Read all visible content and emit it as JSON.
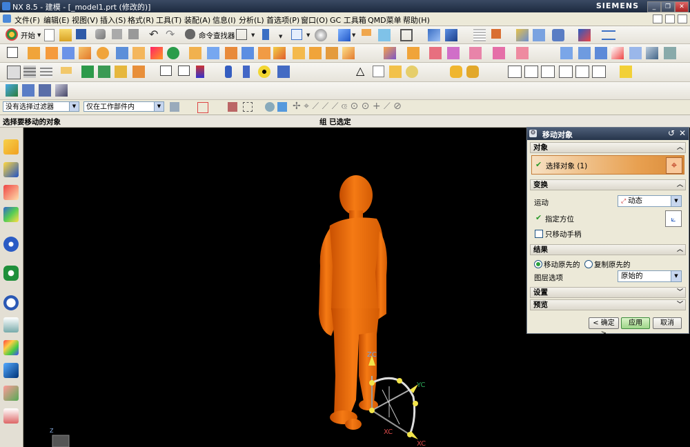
{
  "window": {
    "title": "NX 8.5 - 建模 - [_model1.prt (修改的)]",
    "brand": "SIEMENS",
    "minimize": "_",
    "restore": "❐",
    "close": "✕"
  },
  "menu": [
    {
      "label": "文件(F)"
    },
    {
      "label": "编辑(E)"
    },
    {
      "label": "视图(V)"
    },
    {
      "label": "插入(S)"
    },
    {
      "label": "格式(R)"
    },
    {
      "label": "工具(T)"
    },
    {
      "label": "装配(A)"
    },
    {
      "label": "信息(I)"
    },
    {
      "label": "分析(L)"
    },
    {
      "label": "首选项(P)"
    },
    {
      "label": "窗口(O)"
    },
    {
      "label": "GC 工具箱"
    },
    {
      "label": "QMD菜单"
    },
    {
      "label": "帮助(H)"
    }
  ],
  "toolbar": {
    "start_label": "开始",
    "command_finder_label": "命令查找器"
  },
  "selection_bar": {
    "filter_value": "没有选择过滤器",
    "scope_value": "仅在工作部件内"
  },
  "cue_line": {
    "prompt": "选择要移动的对象",
    "status": "组 已选定"
  },
  "viewport": {
    "axis_labels": {
      "zc": "ZC",
      "yc": "YC",
      "xc": "XC",
      "xc2": "XC",
      "z_small": "Z"
    },
    "model_color": "#e8660c",
    "handle_color": "#f2e44a"
  },
  "dialog": {
    "title": "移动对象",
    "sections": {
      "object": {
        "header": "对象",
        "select_label": "选择对象 (1)"
      },
      "transform": {
        "header": "变换",
        "motion_label": "运动",
        "motion_value": "动态",
        "orientation_label": "指定方位",
        "move_handle_only_label": "只移动手柄"
      },
      "result": {
        "header": "结果",
        "move_original_label": "移动原先的",
        "copy_original_label": "复制原先的",
        "layer_option_label": "图层选项",
        "layer_option_value": "原始的"
      },
      "settings": {
        "header": "设置"
      },
      "preview": {
        "header": "预览"
      }
    },
    "buttons": {
      "ok": "< 确定 >",
      "apply": "应用",
      "cancel": "取消"
    },
    "accent_color": "#e8a050"
  }
}
